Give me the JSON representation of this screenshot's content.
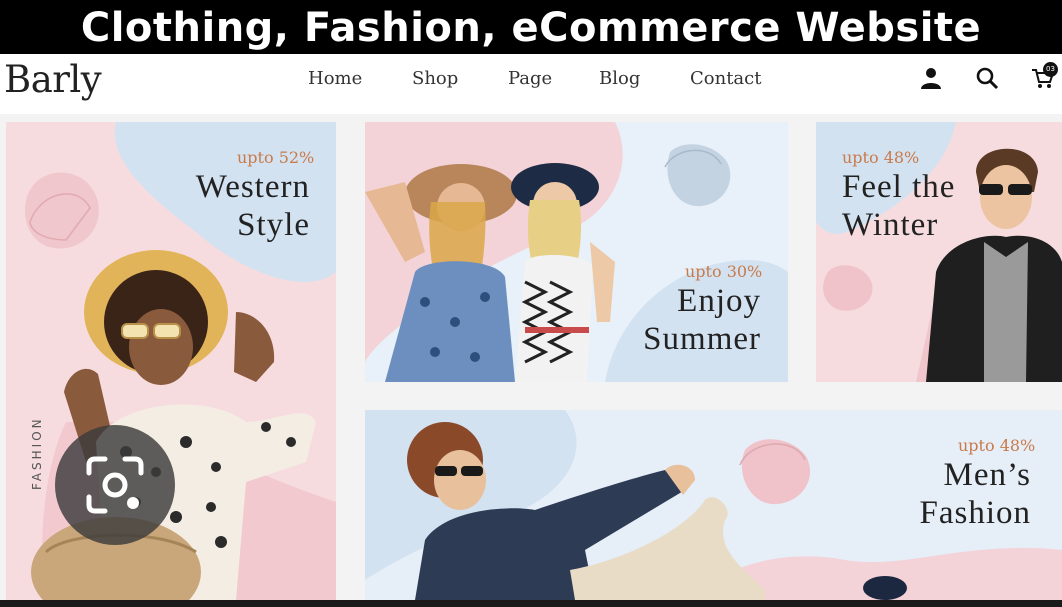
{
  "banner": {
    "title": "Clothing, Fashion, eCommerce Website"
  },
  "header": {
    "logo": "Barly",
    "nav": [
      {
        "label": "Home"
      },
      {
        "label": "Shop"
      },
      {
        "label": "Page"
      },
      {
        "label": "Blog"
      },
      {
        "label": "Contact"
      }
    ],
    "icons": [
      "user-icon",
      "search-icon",
      "cart-icon"
    ],
    "cart_count": "03"
  },
  "cards": {
    "western": {
      "promo": "upto 52%",
      "line1": "Western",
      "line2": "Style",
      "side_text": "FASHION"
    },
    "summer": {
      "promo": "upto 30%",
      "line1": "Enjoy",
      "line2": "Summer"
    },
    "winter": {
      "promo": "upto 48%",
      "line1": "Feel the",
      "line2": "Winter"
    },
    "mens": {
      "promo": "upto 48%",
      "line1": "Men’s",
      "line2": "Fashion"
    }
  },
  "colors": {
    "pink": "#f6dcdf",
    "blue": "#d3e2f1",
    "accent": "#c87a4a",
    "text": "#222222"
  },
  "overlay": {
    "icon": "lens-search-icon"
  }
}
